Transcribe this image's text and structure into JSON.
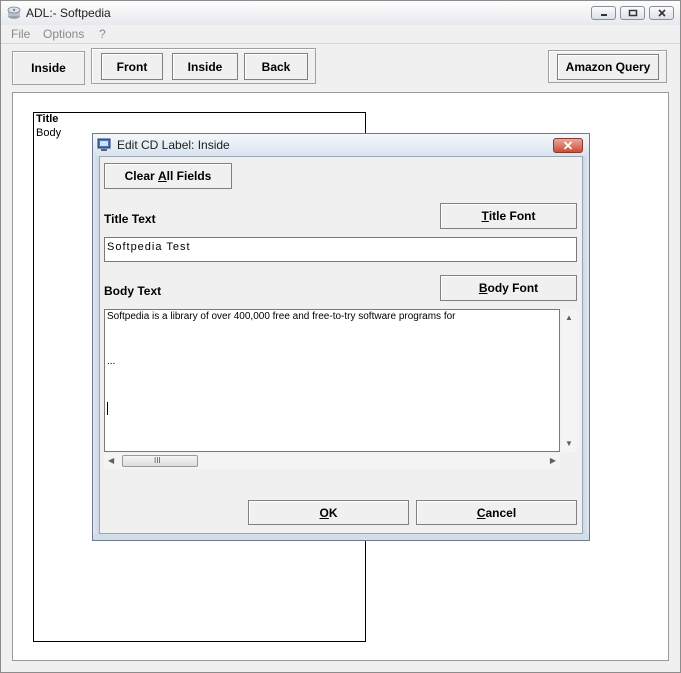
{
  "window": {
    "title": "ADL:- Softpedia"
  },
  "menu": {
    "items": [
      "File",
      "Options",
      "?"
    ]
  },
  "toolbar": {
    "inside_label": "Inside",
    "front_label": "Front",
    "inside2_label": "Inside",
    "back_label": "Back",
    "amazon_label": "Amazon Query"
  },
  "label_preview": {
    "title": "Title",
    "body": "Body"
  },
  "dialog": {
    "title": "Edit CD Label: Inside",
    "clear_all_pre": "Clear ",
    "clear_all_key": "A",
    "clear_all_post": "ll Fields",
    "title_text_label": "Title Text",
    "title_font_key": "T",
    "title_font_post": "itle Font",
    "title_value": "Softpedia Test",
    "body_text_label": "Body Text",
    "body_font_key": "B",
    "body_font_post": "ody Font",
    "body_lines": [
      "Softpedia is a library of over 400,000 free and free-to-try software programs for",
      "",
      "..."
    ],
    "ok_key": "O",
    "ok_post": "K",
    "cancel_key": "C",
    "cancel_post": "ancel",
    "hscroll_grip": "III"
  },
  "colors": {
    "close_red": "#c84d37",
    "window_bg": "#f0f0f0"
  }
}
